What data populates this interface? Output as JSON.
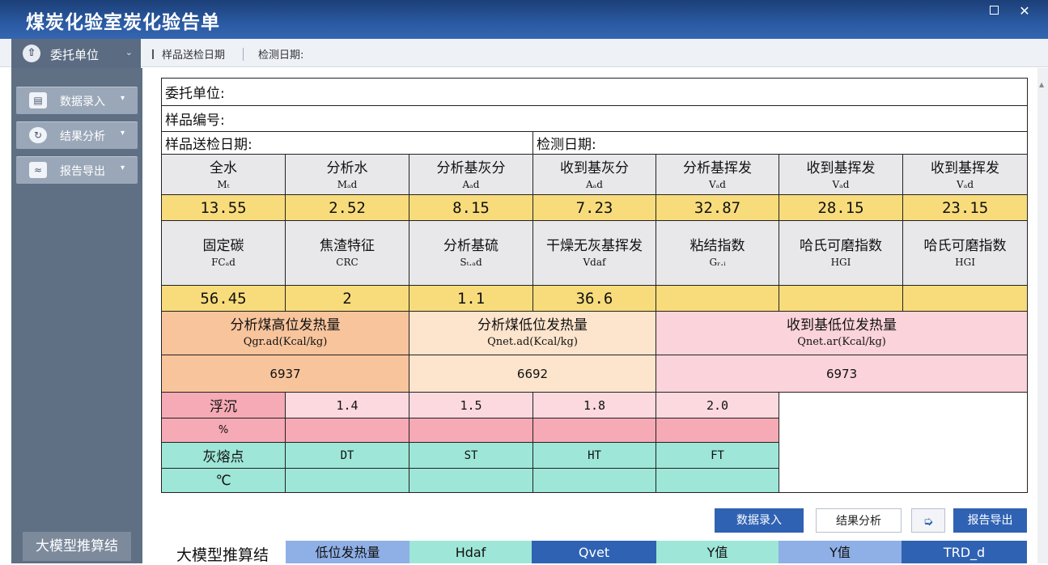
{
  "window": {
    "title": "煤炭化验室炭化验告单"
  },
  "entrust_dropdown": {
    "label": "委托单位"
  },
  "breadcrumb": {
    "sample_date": "样品送检日期",
    "test_date": "检测日期:"
  },
  "sidebar": {
    "items": [
      {
        "label": "数据录入"
      },
      {
        "label": "结果分析"
      },
      {
        "label": "报告导出"
      }
    ],
    "bottom": "大模型推算结"
  },
  "report": {
    "info": {
      "entrust": "委托单位:",
      "sample_no": "样品编号:",
      "sample_date": "样品送检日期:",
      "test_date": "检测日期:"
    },
    "row1_headers": [
      {
        "name": "全水",
        "symbol": "Mₜ"
      },
      {
        "name": "分析水",
        "symbol": "Mₐd"
      },
      {
        "name": "分析基灰分",
        "symbol": "Aₐd"
      },
      {
        "name": "收到基灰分",
        "symbol": "Aₐd"
      },
      {
        "name": "分析基挥发",
        "symbol": "Vₐd"
      },
      {
        "name": "收到基挥发",
        "symbol": "Vₐd"
      },
      {
        "name": "收到基挥发",
        "symbol": "Vₐd"
      }
    ],
    "row1_values": [
      "13.55",
      "2.52",
      "8.15",
      "7.23",
      "32.87",
      "28.15",
      "23.15"
    ],
    "row2_headers": [
      {
        "name": "固定碳",
        "symbol": "FCₐd"
      },
      {
        "name": "焦渣特征",
        "symbol": "CRC"
      },
      {
        "name": "分析基硫",
        "symbol": "Sₜ.ₐd"
      },
      {
        "name": "干燥无灰基挥发",
        "symbol": "Vdaf"
      },
      {
        "name": "粘结指数",
        "symbol": "Gᵣ.ᵢ"
      },
      {
        "name": "哈氏可磨指数",
        "symbol": "HGI"
      },
      {
        "name": "哈氏可磨指数",
        "symbol": "HGI"
      }
    ],
    "row2_values": [
      "56.45",
      "2",
      "1.1",
      "36.6",
      "",
      "",
      ""
    ],
    "heat_headers": [
      {
        "name": "分析煤高位发热量",
        "symbol": "Qgr.ad(Kcal/kg)"
      },
      {
        "name": "分析煤低位发热量",
        "symbol": "Qnet.ad(Kcal/kg)"
      },
      {
        "name": "收到基低位发热量",
        "symbol": "Qnet.ar(Kcal/kg)"
      }
    ],
    "heat_values": [
      "6937",
      "6692",
      "6973"
    ],
    "float_label": "浮沉",
    "float_values": [
      "1.4",
      "1.5",
      "1.8",
      "2.0"
    ],
    "percent_label": "%",
    "ash_label": "灰熔点",
    "ash_values": [
      "DT",
      "ST",
      "HT",
      "FT"
    ],
    "celsius_label": "℃"
  },
  "buttons": {
    "data_entry": "数据录入",
    "result_analysis": "结果分析",
    "export_icon": "export-icon",
    "report_export": "报告导出"
  },
  "model_row": {
    "title": "大模型推算结",
    "cells": [
      "低位发热量",
      "Hdaf",
      "Qvet",
      "Y值",
      "Y值",
      "TRD_d"
    ]
  },
  "colors": {
    "titlebar": "#2a5aa2",
    "sidebar": "#5f6f84",
    "value_yellow": "#f8dc7c",
    "float_pink": "#f5aab5",
    "ash_teal": "#9ee6d8",
    "button_blue": "#2f62b3"
  }
}
